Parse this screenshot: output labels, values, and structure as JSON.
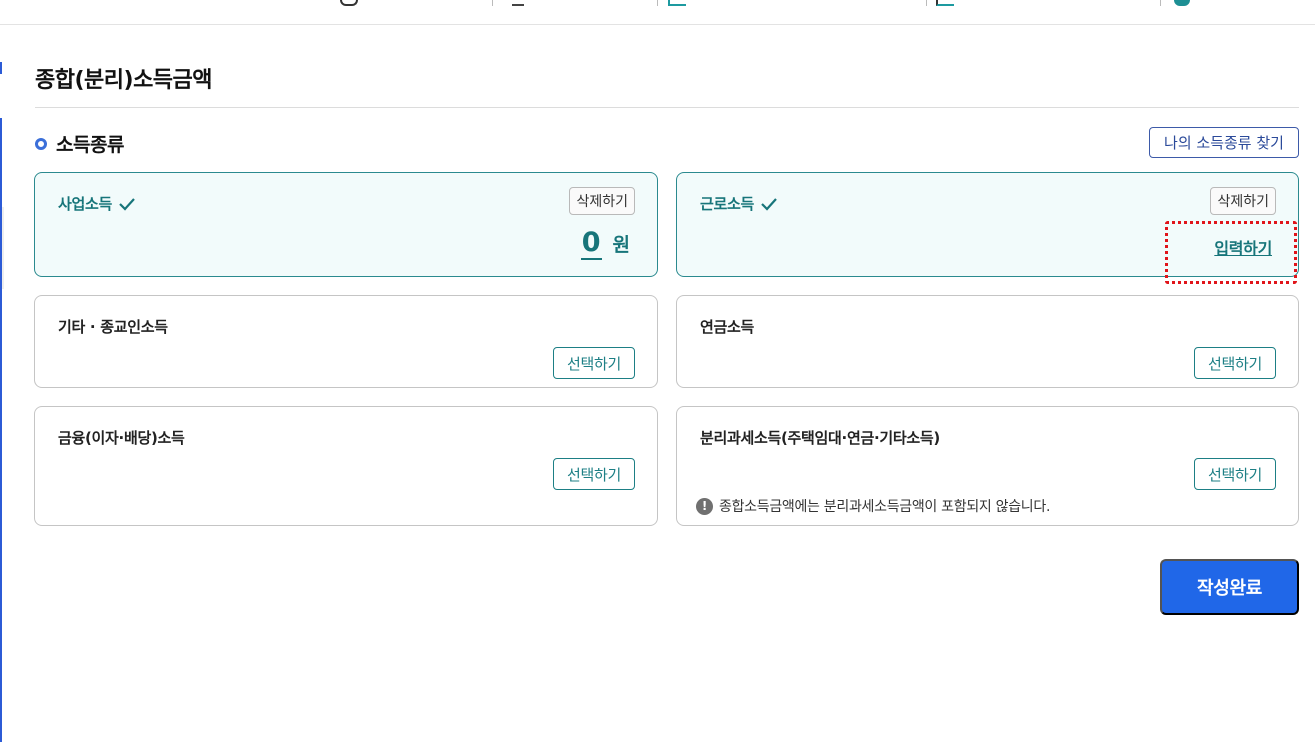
{
  "colors": {
    "accent_teal": "#17757a",
    "primary_blue": "#2067e8",
    "highlight_red": "#e0141a"
  },
  "page_title": "종합(분리)소득금액",
  "section": {
    "title": "소득종류",
    "find_button": "나의 소득종류 찾기"
  },
  "cards": {
    "business": {
      "label": "사업소득",
      "selected": true,
      "delete_label": "삭제하기",
      "amount": "0",
      "unit": "원",
      "check_icon": "check-icon"
    },
    "earned": {
      "label": "근로소득",
      "selected": true,
      "delete_label": "삭제하기",
      "input_label": "입력하기",
      "check_icon": "check-icon"
    },
    "other": {
      "label": "기타 · 종교인소득",
      "select_label": "선택하기"
    },
    "pension": {
      "label": "연금소득",
      "select_label": "선택하기"
    },
    "financial": {
      "label": "금융(이자·배당)소득",
      "select_label": "선택하기"
    },
    "separate": {
      "label": "분리과세소득(주택임대·연금·기타소득)",
      "select_label": "선택하기",
      "note_icon": "info-icon",
      "note": "종합소득금액에는 분리과세소득금액이 포함되지 않습니다."
    }
  },
  "submit_label": "작성완료"
}
